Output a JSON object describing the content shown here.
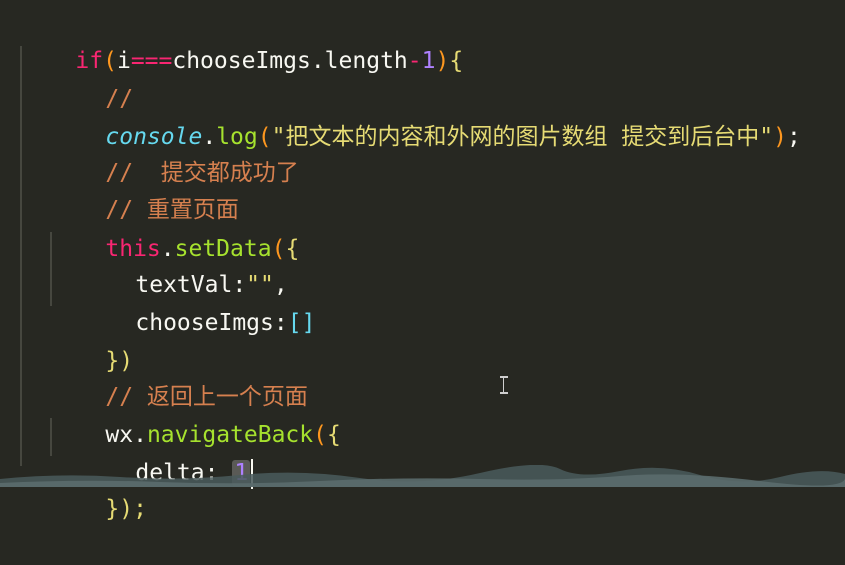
{
  "code": {
    "line1": {
      "kw_if": "if",
      "paren_open": "(",
      "var_i": "i",
      "op": "===",
      "var_imgs": "chooseImgs.length",
      "minus": "-",
      "num": "1",
      "paren_close": ")",
      "brace": "{"
    },
    "line2": {
      "comment": "//"
    },
    "line3": {
      "obj": "console",
      "dot": ".",
      "fn": "log",
      "paren_open": "(",
      "str": "\"把文本的内容和外网的图片数组 提交到后台中\"",
      "paren_close": ")",
      "semi": ";"
    },
    "line4": {
      "comment": "//  提交都成功了"
    },
    "line5": {
      "comment": "// 重置页面"
    },
    "line6": {
      "kw_this": "this",
      "dot": ".",
      "fn": "setData",
      "paren_open": "(",
      "brace": "{"
    },
    "line7": {
      "key": "textVal:",
      "str": "\"\"",
      "comma": ","
    },
    "line8": {
      "key": "chooseImgs:",
      "bracket": "[]"
    },
    "line9": {
      "close": "})"
    },
    "line10": {
      "comment": "// 返回上一个页面"
    },
    "line11": {
      "obj": "wx",
      "dot": ".",
      "fn": "navigateBack",
      "paren_open": "(",
      "brace": "{"
    },
    "line12": {
      "key": "delta: ",
      "num": "1"
    },
    "line13": {
      "close": "});"
    }
  },
  "theme": {
    "background": "#272822",
    "keyword": "#f92672",
    "number": "#ae81ff",
    "comment": "#d6804f",
    "function": "#a6e22e",
    "builtin": "#66d9ef",
    "string": "#e6db74"
  },
  "icons": {
    "cursor": "text-cursor-icon",
    "mouse": "i-beam-pointer-icon"
  }
}
